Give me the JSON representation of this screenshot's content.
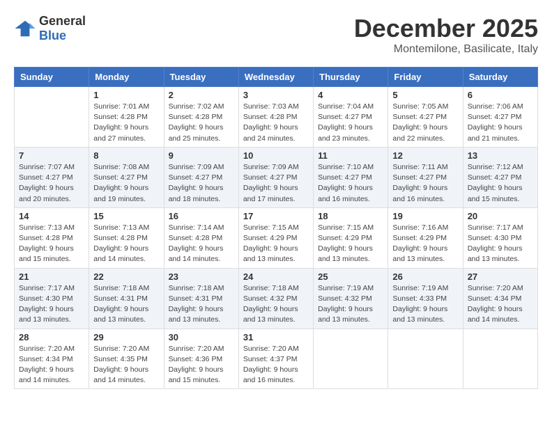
{
  "header": {
    "logo_general": "General",
    "logo_blue": "Blue",
    "month": "December 2025",
    "location": "Montemilone, Basilicate, Italy"
  },
  "weekdays": [
    "Sunday",
    "Monday",
    "Tuesday",
    "Wednesday",
    "Thursday",
    "Friday",
    "Saturday"
  ],
  "weeks": [
    [
      {
        "day": "",
        "info": ""
      },
      {
        "day": "1",
        "info": "Sunrise: 7:01 AM\nSunset: 4:28 PM\nDaylight: 9 hours\nand 27 minutes."
      },
      {
        "day": "2",
        "info": "Sunrise: 7:02 AM\nSunset: 4:28 PM\nDaylight: 9 hours\nand 25 minutes."
      },
      {
        "day": "3",
        "info": "Sunrise: 7:03 AM\nSunset: 4:28 PM\nDaylight: 9 hours\nand 24 minutes."
      },
      {
        "day": "4",
        "info": "Sunrise: 7:04 AM\nSunset: 4:27 PM\nDaylight: 9 hours\nand 23 minutes."
      },
      {
        "day": "5",
        "info": "Sunrise: 7:05 AM\nSunset: 4:27 PM\nDaylight: 9 hours\nand 22 minutes."
      },
      {
        "day": "6",
        "info": "Sunrise: 7:06 AM\nSunset: 4:27 PM\nDaylight: 9 hours\nand 21 minutes."
      }
    ],
    [
      {
        "day": "7",
        "info": "Sunrise: 7:07 AM\nSunset: 4:27 PM\nDaylight: 9 hours\nand 20 minutes."
      },
      {
        "day": "8",
        "info": "Sunrise: 7:08 AM\nSunset: 4:27 PM\nDaylight: 9 hours\nand 19 minutes."
      },
      {
        "day": "9",
        "info": "Sunrise: 7:09 AM\nSunset: 4:27 PM\nDaylight: 9 hours\nand 18 minutes."
      },
      {
        "day": "10",
        "info": "Sunrise: 7:09 AM\nSunset: 4:27 PM\nDaylight: 9 hours\nand 17 minutes."
      },
      {
        "day": "11",
        "info": "Sunrise: 7:10 AM\nSunset: 4:27 PM\nDaylight: 9 hours\nand 16 minutes."
      },
      {
        "day": "12",
        "info": "Sunrise: 7:11 AM\nSunset: 4:27 PM\nDaylight: 9 hours\nand 16 minutes."
      },
      {
        "day": "13",
        "info": "Sunrise: 7:12 AM\nSunset: 4:27 PM\nDaylight: 9 hours\nand 15 minutes."
      }
    ],
    [
      {
        "day": "14",
        "info": "Sunrise: 7:13 AM\nSunset: 4:28 PM\nDaylight: 9 hours\nand 15 minutes."
      },
      {
        "day": "15",
        "info": "Sunrise: 7:13 AM\nSunset: 4:28 PM\nDaylight: 9 hours\nand 14 minutes."
      },
      {
        "day": "16",
        "info": "Sunrise: 7:14 AM\nSunset: 4:28 PM\nDaylight: 9 hours\nand 14 minutes."
      },
      {
        "day": "17",
        "info": "Sunrise: 7:15 AM\nSunset: 4:29 PM\nDaylight: 9 hours\nand 13 minutes."
      },
      {
        "day": "18",
        "info": "Sunrise: 7:15 AM\nSunset: 4:29 PM\nDaylight: 9 hours\nand 13 minutes."
      },
      {
        "day": "19",
        "info": "Sunrise: 7:16 AM\nSunset: 4:29 PM\nDaylight: 9 hours\nand 13 minutes."
      },
      {
        "day": "20",
        "info": "Sunrise: 7:17 AM\nSunset: 4:30 PM\nDaylight: 9 hours\nand 13 minutes."
      }
    ],
    [
      {
        "day": "21",
        "info": "Sunrise: 7:17 AM\nSunset: 4:30 PM\nDaylight: 9 hours\nand 13 minutes."
      },
      {
        "day": "22",
        "info": "Sunrise: 7:18 AM\nSunset: 4:31 PM\nDaylight: 9 hours\nand 13 minutes."
      },
      {
        "day": "23",
        "info": "Sunrise: 7:18 AM\nSunset: 4:31 PM\nDaylight: 9 hours\nand 13 minutes."
      },
      {
        "day": "24",
        "info": "Sunrise: 7:18 AM\nSunset: 4:32 PM\nDaylight: 9 hours\nand 13 minutes."
      },
      {
        "day": "25",
        "info": "Sunrise: 7:19 AM\nSunset: 4:32 PM\nDaylight: 9 hours\nand 13 minutes."
      },
      {
        "day": "26",
        "info": "Sunrise: 7:19 AM\nSunset: 4:33 PM\nDaylight: 9 hours\nand 13 minutes."
      },
      {
        "day": "27",
        "info": "Sunrise: 7:20 AM\nSunset: 4:34 PM\nDaylight: 9 hours\nand 14 minutes."
      }
    ],
    [
      {
        "day": "28",
        "info": "Sunrise: 7:20 AM\nSunset: 4:34 PM\nDaylight: 9 hours\nand 14 minutes."
      },
      {
        "day": "29",
        "info": "Sunrise: 7:20 AM\nSunset: 4:35 PM\nDaylight: 9 hours\nand 14 minutes."
      },
      {
        "day": "30",
        "info": "Sunrise: 7:20 AM\nSunset: 4:36 PM\nDaylight: 9 hours\nand 15 minutes."
      },
      {
        "day": "31",
        "info": "Sunrise: 7:20 AM\nSunset: 4:37 PM\nDaylight: 9 hours\nand 16 minutes."
      },
      {
        "day": "",
        "info": ""
      },
      {
        "day": "",
        "info": ""
      },
      {
        "day": "",
        "info": ""
      }
    ]
  ]
}
